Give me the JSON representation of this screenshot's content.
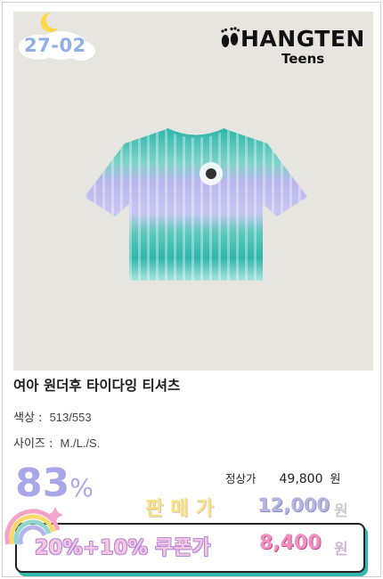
{
  "badge": {
    "date": "27-02"
  },
  "brand": {
    "name": "HANGTEN",
    "sub": "Teens"
  },
  "product": {
    "title": "여아 원더후 타이다잉 티셔츠",
    "color_label": "색상 :",
    "color_value": "513/553",
    "size_label": "사이즈 :",
    "size_value": "M./L./S."
  },
  "pricing": {
    "discount_value": "83",
    "discount_symbol": "%",
    "regular_label": "정상가",
    "regular_value": "49,800",
    "regular_unit": "원",
    "sale_label": "판매가",
    "sale_value": "12,000",
    "sale_unit": "원",
    "coupon_label": "20%+10% 쿠폰가",
    "coupon_value": "8,400",
    "coupon_unit": "원"
  },
  "colors": {
    "image_bg": "#e6e5e0",
    "discount": "#a8a8e8",
    "teal": "#2fb6ac",
    "lavender": "#b7b4ec",
    "pink": "#f28fc2"
  },
  "icons": [
    "moon-icon",
    "cloud-icon",
    "feet-logo-icon",
    "rainbow-icon"
  ]
}
